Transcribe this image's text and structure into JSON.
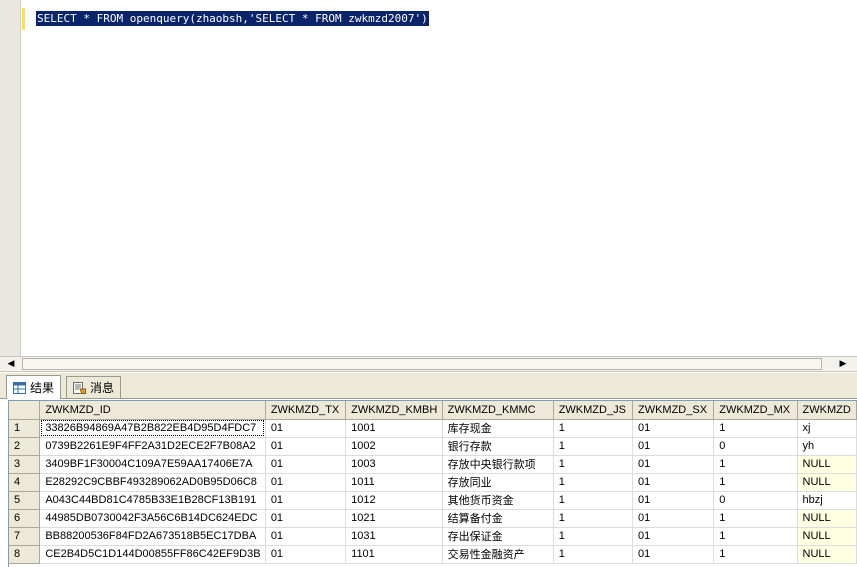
{
  "editor": {
    "query_text": "SELECT * FROM openquery(zhaobsh,'SELECT * FROM zwkmzd2007')"
  },
  "tabs": [
    {
      "label": "结果",
      "icon": "grid-icon",
      "active": true
    },
    {
      "label": "消息",
      "icon": "message-icon",
      "active": false
    }
  ],
  "grid": {
    "columns": [
      "ZWKMZD_ID",
      "ZWKMZD_TX",
      "ZWKMZD_KMBH",
      "ZWKMZD_KMMC",
      "ZWKMZD_JS",
      "ZWKMZD_SX",
      "ZWKMZD_MX",
      "ZWKMZD"
    ],
    "rows": [
      {
        "num": "1",
        "cells": [
          "33826B94869A47B2B822EB4D95D4FDC7",
          "01",
          "1001",
          "库存现金",
          "1",
          "01",
          "1",
          "xj"
        ]
      },
      {
        "num": "2",
        "cells": [
          "0739B2261E9F4FF2A31D2ECE2F7B08A2",
          "01",
          "1002",
          "银行存款",
          "1",
          "01",
          "0",
          "yh"
        ]
      },
      {
        "num": "3",
        "cells": [
          "3409BF1F30004C109A7E59AA17406E7A",
          "01",
          "1003",
          "存放中央银行款项",
          "1",
          "01",
          "1",
          "NULL"
        ]
      },
      {
        "num": "4",
        "cells": [
          "E28292C9CBBF493289062AD0B95D06C8",
          "01",
          "1011",
          "存放同业",
          "1",
          "01",
          "1",
          "NULL"
        ]
      },
      {
        "num": "5",
        "cells": [
          "A043C44BD81C4785B33E1B28CF13B191",
          "01",
          "1012",
          "其他货币资金",
          "1",
          "01",
          "0",
          "hbzj"
        ]
      },
      {
        "num": "6",
        "cells": [
          "44985DB0730042F3A56C6B14DC624EDC",
          "01",
          "1021",
          "结算备付金",
          "1",
          "01",
          "1",
          "NULL"
        ]
      },
      {
        "num": "7",
        "cells": [
          "BB88200536F84FD2A673518B5EC17DBA",
          "01",
          "1031",
          "存出保证金",
          "1",
          "01",
          "1",
          "NULL"
        ]
      },
      {
        "num": "8",
        "cells": [
          "CE2B4D5C1D144D00855FF86C42EF9D3B",
          "01",
          "1101",
          "交易性金融资产",
          "1",
          "01",
          "1",
          "NULL"
        ]
      }
    ]
  }
}
